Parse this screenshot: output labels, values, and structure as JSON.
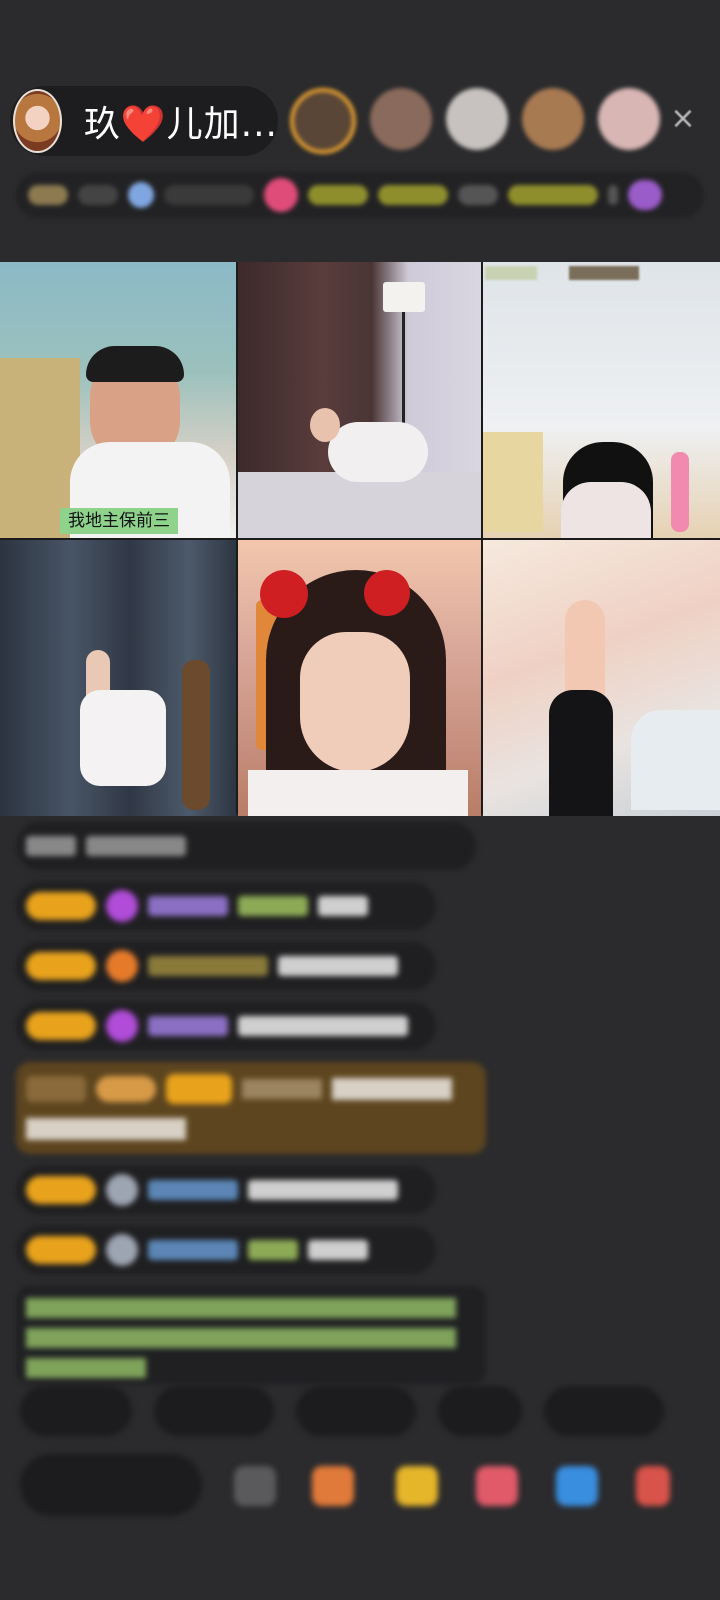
{
  "header": {
    "host_name": "玖❤️儿加...",
    "close_icon": "×"
  },
  "grid": {
    "tile1_caption": "我地主保前三"
  },
  "colors": {
    "background": "#2b2b2d",
    "level_badge": "#e8a21c",
    "caption_bg": "#8ed28c"
  }
}
